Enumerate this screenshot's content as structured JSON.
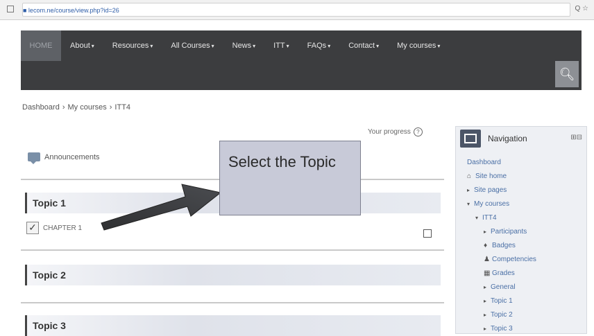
{
  "browser": {
    "url": "■ lecom.ne/course/view.php?id=26",
    "right": "Q ☆"
  },
  "nav": {
    "items": [
      {
        "label": "HOME",
        "caret": false
      },
      {
        "label": "About",
        "caret": true
      },
      {
        "label": "Resources",
        "caret": true
      },
      {
        "label": "All Courses",
        "caret": true
      },
      {
        "label": "News",
        "caret": true
      },
      {
        "label": "ITT",
        "caret": true
      },
      {
        "label": "FAQs",
        "caret": true
      },
      {
        "label": "Contact",
        "caret": true
      },
      {
        "label": "My courses",
        "caret": true
      }
    ],
    "search_icon": "search-icon"
  },
  "breadcrumb": [
    "Dashboard",
    "My courses",
    "ITT4"
  ],
  "main": {
    "progress_label": "Your progress",
    "announcements": "Announcements",
    "topics": [
      "Topic 1",
      "Topic 2",
      "Topic 3"
    ],
    "chapter": "CHAPTER 1"
  },
  "callout": {
    "text": "Select the Topic"
  },
  "navigation": {
    "title": "Navigation",
    "tools": "⊞⊟",
    "items": [
      {
        "label": "Dashboard",
        "indent": 0,
        "marker": "",
        "icon": ""
      },
      {
        "label": "Site home",
        "indent": 0,
        "marker": "",
        "icon": "home-icon"
      },
      {
        "label": "Site pages",
        "indent": 0,
        "marker": "▸",
        "icon": ""
      },
      {
        "label": "My courses",
        "indent": 0,
        "marker": "▾",
        "icon": ""
      },
      {
        "label": "ITT4",
        "indent": 1,
        "marker": "▾",
        "icon": ""
      },
      {
        "label": "Participants",
        "indent": 2,
        "marker": "▸",
        "icon": ""
      },
      {
        "label": "Badges",
        "indent": 2,
        "marker": "",
        "icon": "badge-icon"
      },
      {
        "label": "Competencies",
        "indent": 2,
        "marker": "",
        "icon": "user-icon"
      },
      {
        "label": "Grades",
        "indent": 2,
        "marker": "",
        "icon": "grades-icon"
      },
      {
        "label": "General",
        "indent": 2,
        "marker": "▸",
        "icon": ""
      },
      {
        "label": "Topic 1",
        "indent": 2,
        "marker": "▸",
        "icon": ""
      },
      {
        "label": "Topic 2",
        "indent": 2,
        "marker": "▸",
        "icon": ""
      },
      {
        "label": "Topic 3",
        "indent": 2,
        "marker": "▸",
        "icon": ""
      }
    ]
  }
}
